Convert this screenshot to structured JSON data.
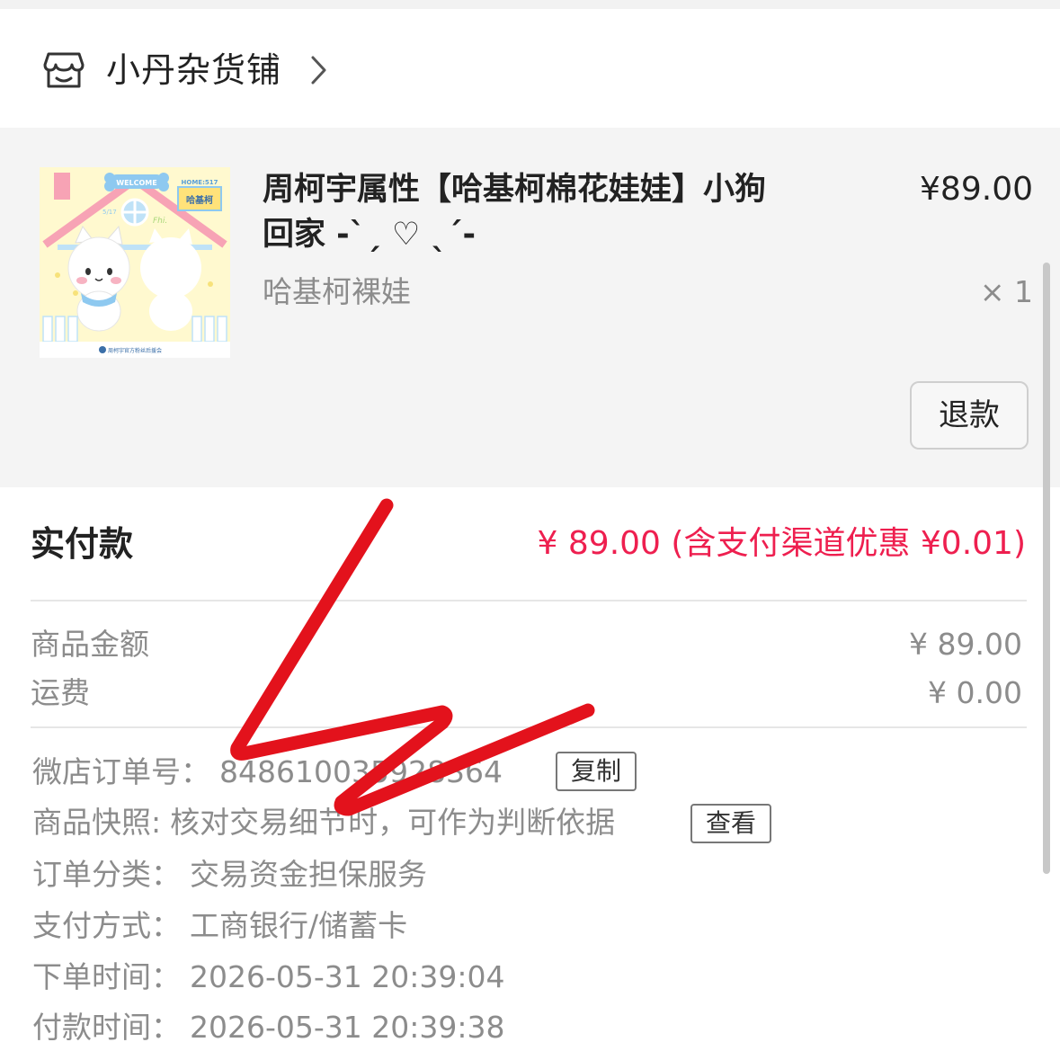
{
  "shop": {
    "name": "小丹杂货铺",
    "icon": "store-icon",
    "arrow_icon": "chevron-right-icon"
  },
  "product": {
    "title": "周柯宇属性【哈基柯棉花娃娃】小狗回家 -ˋˏ ♡ ˎˊ-",
    "price": "¥89.00",
    "sku": "哈基柯裸娃",
    "quantity": "× 1",
    "refund_label": "退款",
    "thumbnail": {
      "welcome": "WELCOME",
      "home": "HOME:517",
      "sign": "哈基柯",
      "date": "5/17",
      "tag": "Fhi.",
      "footer": "周柯宇官方粉丝后援会"
    }
  },
  "payment": {
    "paid_label": "实付款",
    "paid_value": "¥ 89.00 (含支付渠道优惠 ¥0.01)",
    "rows": [
      {
        "label": "商品金额",
        "value": "¥ 89.00"
      },
      {
        "label": "运费",
        "value": "¥ 0.00"
      }
    ]
  },
  "order": {
    "number_label": "微店订单号：",
    "number_value": "848610035928364",
    "copy_label": "复制",
    "snapshot_label": "商品快照:",
    "snapshot_value": "核对交易细节时，可作为判断依据",
    "view_label": "查看",
    "category_label": "订单分类：",
    "category_value": "交易资金担保服务",
    "pay_method_label": "支付方式：",
    "pay_method_value": "工商银行/储蓄卡",
    "order_time_label": "下单时间：",
    "order_time_value": "2026-05-31 20:39:04",
    "pay_time_label": "付款时间：",
    "pay_time_value": "2026-05-31 20:39:38"
  },
  "colors": {
    "accent_red": "#ee1f4f",
    "scribble": "#e3121c",
    "muted_text": "#8c8c8c"
  }
}
